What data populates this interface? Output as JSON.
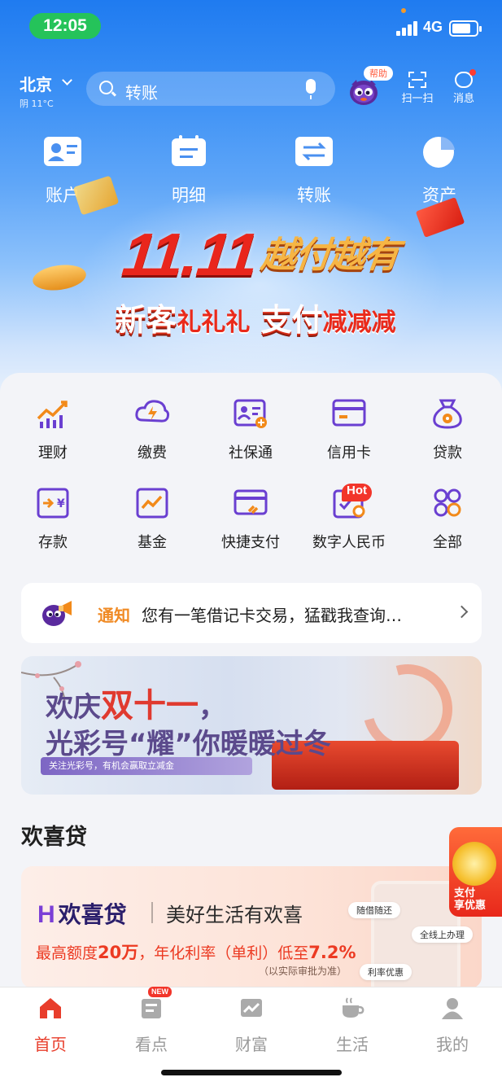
{
  "status_bar": {
    "time": "12:05",
    "network": "4G"
  },
  "header": {
    "city": "北京",
    "weather": "阴 11°C",
    "search_placeholder": "转账",
    "help_badge": "帮助",
    "scan_label": "扫一扫",
    "message_label": "消息"
  },
  "quick_entries": [
    {
      "label": "账户",
      "icon": "account-card-icon"
    },
    {
      "label": "明细",
      "icon": "detail-list-icon"
    },
    {
      "label": "转账",
      "icon": "transfer-arrows-icon"
    },
    {
      "label": "资产",
      "icon": "assets-pie-icon"
    }
  ],
  "hero_banner": {
    "headline_number": "11.11",
    "headline_text": "越付越有",
    "sub_a": "新客",
    "sub_b": "礼礼礼",
    "sub_c": "支付",
    "sub_d": "减减减"
  },
  "services": [
    {
      "label": "理财",
      "icon": "wealth-chart-icon"
    },
    {
      "label": "缴费",
      "icon": "bill-lightning-icon"
    },
    {
      "label": "社保通",
      "icon": "social-security-card-icon"
    },
    {
      "label": "信用卡",
      "icon": "credit-card-icon"
    },
    {
      "label": "贷款",
      "icon": "money-bag-icon"
    },
    {
      "label": "存款",
      "icon": "deposit-icon"
    },
    {
      "label": "基金",
      "icon": "fund-chart-icon"
    },
    {
      "label": "快捷支付",
      "icon": "quick-pay-card-icon"
    },
    {
      "label": "数字人民币",
      "icon": "digital-rmb-icon"
    },
    {
      "label": "全部",
      "icon": "grid-all-icon"
    }
  ],
  "hot_badge": "Hot",
  "notice": {
    "tag": "通知",
    "text": "您有一笔借记卡交易，猛戳我查询…"
  },
  "promo": {
    "line1_a": "欢庆",
    "line1_b": "双十一",
    "line1_c": "，",
    "line2": "光彩号“耀”你暖暖过冬",
    "strip": "关注光彩号，有机会赢取立减金"
  },
  "section": {
    "title": "欢喜贷",
    "logo": "欢喜贷",
    "slogan": "美好生活有欢喜",
    "rate_a": "最高额度",
    "rate_b": "20万",
    "rate_c": "，年化利率（单利）低至",
    "rate_d": "7.2%",
    "note": "（以实际审批为准）",
    "chip_1": "随借随还",
    "chip_2": "全线上办理",
    "chip_3": "利率优惠"
  },
  "float_ad": {
    "line1": "支付",
    "line2": "享优惠"
  },
  "tabbar": [
    {
      "label": "首页",
      "active": true
    },
    {
      "label": "看点",
      "active": false
    },
    {
      "label": "财富",
      "active": false
    },
    {
      "label": "生活",
      "active": false
    },
    {
      "label": "我的",
      "active": false
    }
  ],
  "tab_new_badge": "NEW",
  "colors": {
    "primary_blue": "#1f7bf0",
    "accent_red": "#e83d2b",
    "icon_purple": "#6a3fd1",
    "icon_orange": "#f28a1a"
  }
}
